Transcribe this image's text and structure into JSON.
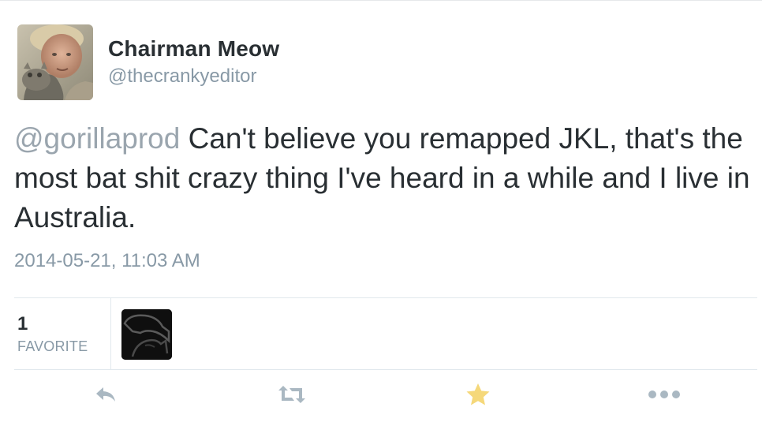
{
  "tweet": {
    "author": {
      "display_name": "Chairman Meow",
      "username": "@thecrankyeditor"
    },
    "text": {
      "mention": "@gorillaprod",
      "body": " Can't believe you remapped JKL, that's the most bat shit crazy thing I've heard in a while and I live in Australia."
    },
    "timestamp": "2014-05-21, 11:03 AM"
  },
  "stats": {
    "favorite_count": "1",
    "favorite_label": "FAVORITE"
  },
  "actions": {
    "icons": [
      "reply-icon",
      "retweet-icon",
      "star-icon",
      "more-icon"
    ]
  },
  "colors": {
    "text": "#292f33",
    "secondary": "#8899a6",
    "mention": "#9aa5ae",
    "favorite_star": "#f5d87a",
    "action_icon": "#aab8c2",
    "divider": "#e1e8ed"
  }
}
